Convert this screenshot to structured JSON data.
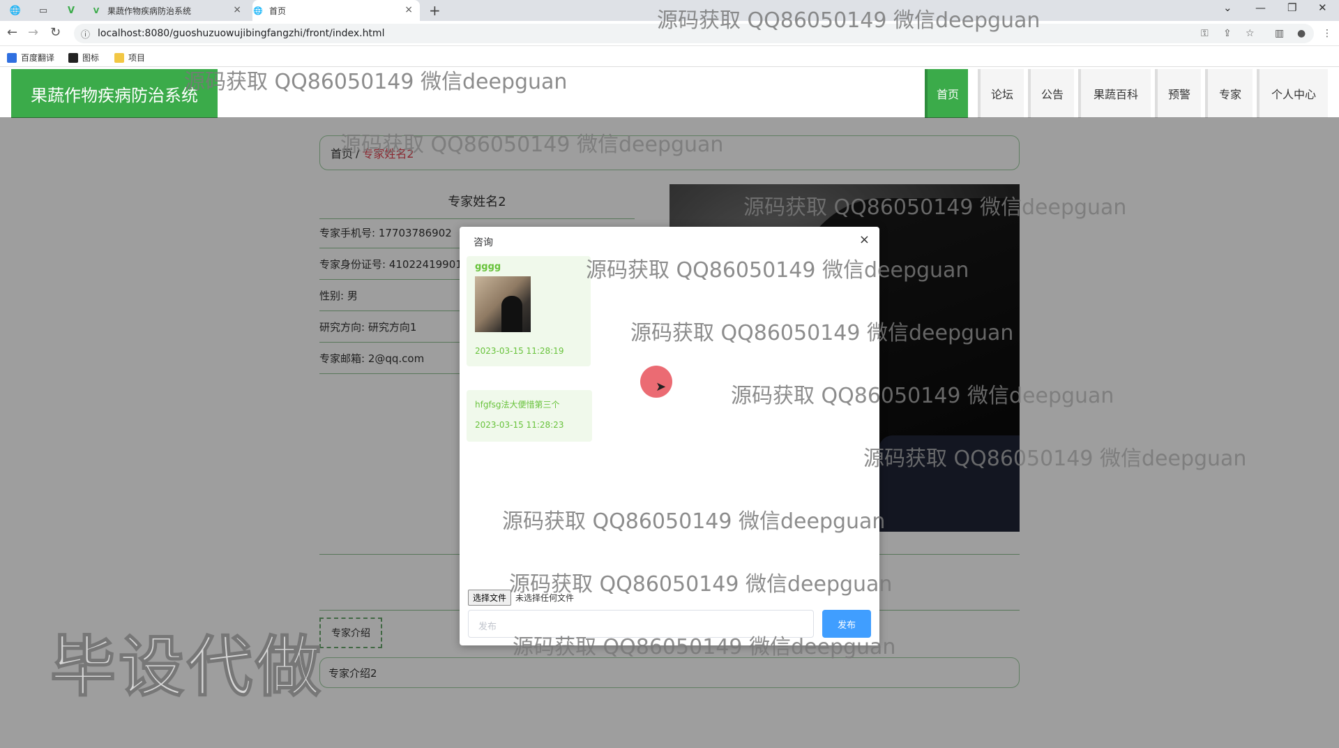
{
  "browser": {
    "tabs": [
      {
        "title": ""
      },
      {
        "title": ""
      },
      {
        "title": "果蔬作物疾病防治系统"
      },
      {
        "title": "首页"
      }
    ],
    "url": "localhost:8080/guoshuzuowujibingfangzhi/front/index.html",
    "bookmarks": [
      "百度翻译",
      "图标",
      "项目"
    ]
  },
  "site": {
    "brand": "果蔬作物疾病防治系统",
    "nav": [
      "首页",
      "论坛",
      "公告",
      "果蔬百科",
      "预警",
      "专家",
      "个人中心"
    ]
  },
  "breadcrumb": {
    "home": "首页",
    "sep": "/",
    "current": "专家姓名2"
  },
  "expert": {
    "name": "专家姓名2",
    "fields": [
      "专家手机号: 17703786902",
      "专家身份证号: 41022419901",
      "性别: 男",
      "研究方向: 研究方向1",
      "专家邮箱: 2@qq.com"
    ],
    "intro_tab": "专家介绍",
    "intro": "专家介绍2"
  },
  "dialog": {
    "title": "咨询",
    "close": "×",
    "messages": [
      {
        "user": "gggg",
        "time": "2023-03-15 11:28:19"
      },
      {
        "text": "hfgfsg法大便惜第三个",
        "time": "2023-03-15 11:28:23"
      }
    ],
    "file_button": "选择文件",
    "file_status": "未选择任何文件",
    "input_placeholder": "发布",
    "send": "发布"
  },
  "watermarks": {
    "text": "源码获取 QQ86050149 微信deepguan",
    "big": "毕设代做"
  },
  "colors": {
    "brand_green": "#3bab4a",
    "send_blue": "#409eff",
    "message_bg": "#f0f9eb",
    "breadcrumb_current": "#e0424f"
  }
}
